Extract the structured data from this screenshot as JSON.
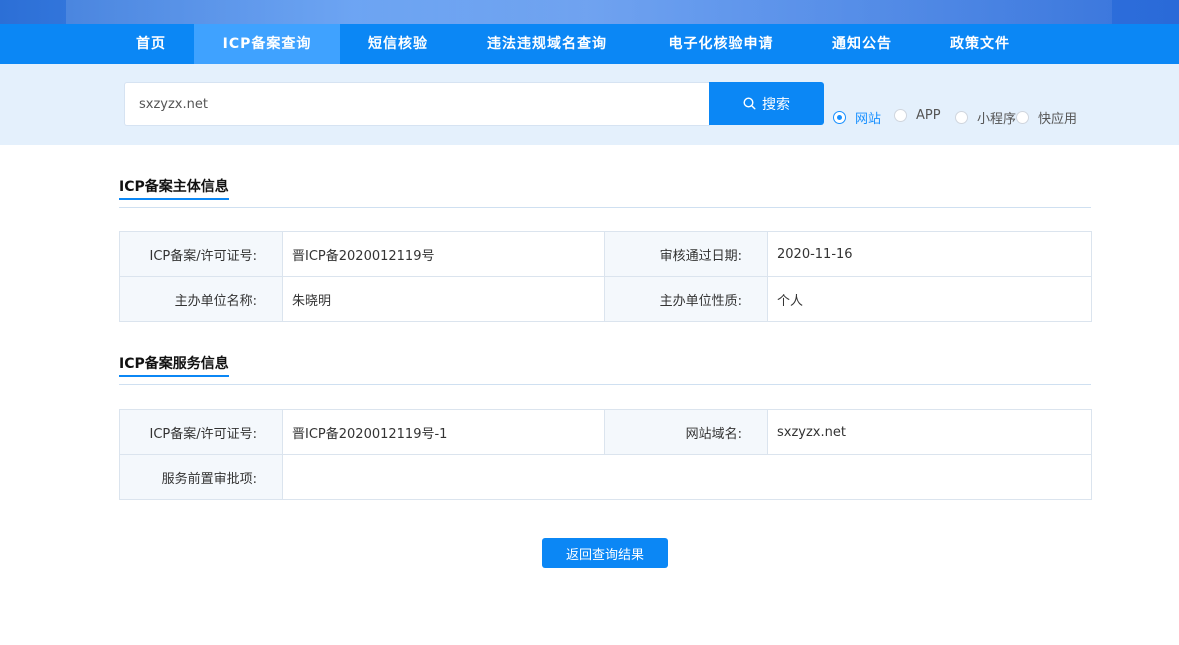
{
  "nav": {
    "items": [
      {
        "label": "首页"
      },
      {
        "label": "ICP备案查询"
      },
      {
        "label": "短信核验"
      },
      {
        "label": "违法违规域名查询"
      },
      {
        "label": "电子化核验申请"
      },
      {
        "label": "通知公告"
      },
      {
        "label": "政策文件"
      }
    ],
    "active_index": 1
  },
  "search": {
    "value": "sxzyzx.net",
    "button_label": "搜索",
    "types": [
      {
        "label": "网站",
        "checked": true
      },
      {
        "label": "APP",
        "checked": false
      },
      {
        "label": "小程序",
        "checked": false
      },
      {
        "label": "快应用",
        "checked": false
      }
    ]
  },
  "subject_section": {
    "title": "ICP备案主体信息",
    "rows": [
      {
        "k1": "ICP备案/许可证号:",
        "v1": "晋ICP备2020012119号",
        "k2": "审核通过日期:",
        "v2": "2020-11-16"
      },
      {
        "k1": "主办单位名称:",
        "v1": "朱晓明",
        "k2": "主办单位性质:",
        "v2": "个人"
      }
    ]
  },
  "service_section": {
    "title": "ICP备案服务信息",
    "license_key": "ICP备案/许可证号:",
    "license_value": "晋ICP备2020012119号-1",
    "domain_key": "网站域名:",
    "domain_value": "sxzyzx.net",
    "approval_key": "服务前置审批项:",
    "approval_value": ""
  },
  "back_button_label": "返回查询结果",
  "colors": {
    "primary": "#0b87f5",
    "nav_active": "#3fa2ff",
    "search_band": "#e4f0fc"
  }
}
